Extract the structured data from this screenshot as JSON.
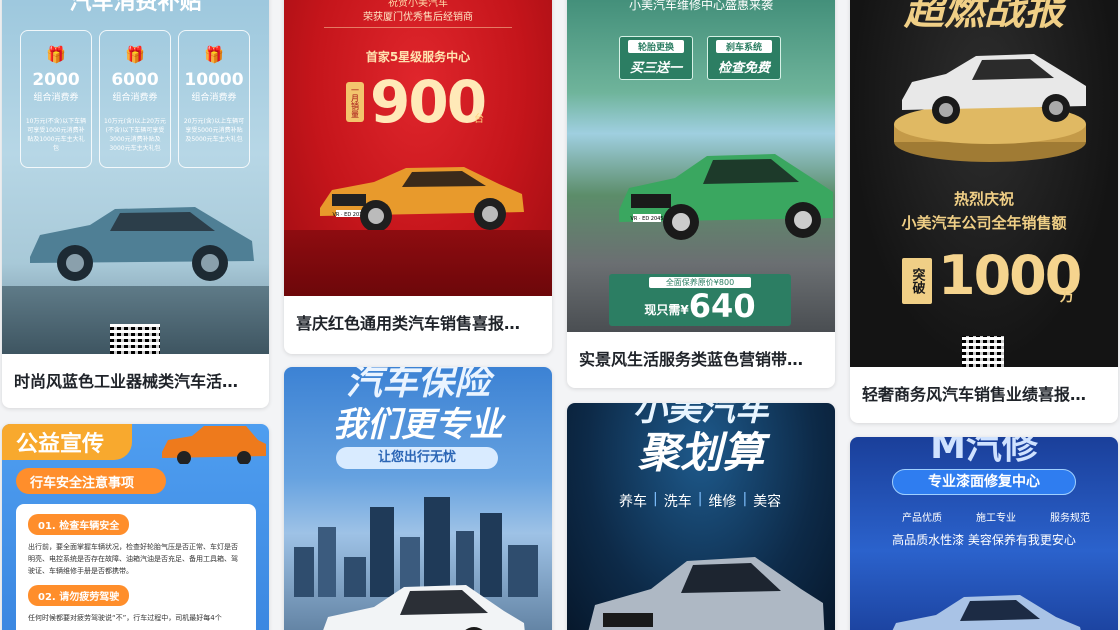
{
  "cards": [
    {
      "title": "时尚风蓝色工业器械类汽车活…",
      "poster": {
        "header": "汽车消费补贴",
        "vouchers": [
          {
            "amount": "2000",
            "label": "组合消费券",
            "desc": "10万元(不含)以下车辆可享受1000元消费补贴及1000元车主大礼包"
          },
          {
            "amount": "6000",
            "label": "组合消费券",
            "desc": "10万元(含)以上20万元(不含)以下车辆可享受3000元消费补贴及3000元车主大礼包"
          },
          {
            "amount": "10000",
            "label": "组合消费券",
            "desc": "20万元(含)以上车辆可享受5000元消费补贴及5000元车主大礼包"
          }
        ]
      }
    },
    {
      "title": "喜庆红色通用类汽车销售喜报…",
      "poster": {
        "top_line1": "祝贺小美汽车",
        "top_line2": "荣获厦门优秀售后经销商",
        "subtitle": "首家5星级服务中心",
        "side_label": "一月销量",
        "number": "900",
        "unit": "台",
        "plate": "VR · ED 2015"
      }
    },
    {
      "title": "实景风生活服务类蓝色营销带…",
      "poster": {
        "top": "小美汽车维修中心盛惠来袭",
        "tag1_head": "轮胎更换",
        "tag1_body": "买三送一",
        "tag2_head": "刹车系统",
        "tag2_body": "检查免费",
        "plate": "VR · ED 2045",
        "orig": "全面保养原价¥800",
        "now_label": "现只需¥",
        "price": "640"
      }
    },
    {
      "title": "轻奢商务风汽车销售业绩喜报…",
      "poster": {
        "header": "超燃战报",
        "line1": "热烈庆祝",
        "line2": "小美汽车公司全年销售额",
        "badge": "突破",
        "number": "1000",
        "unit": "万"
      }
    },
    {
      "title": "",
      "poster": {
        "banner": "公益宣传",
        "sub": "行车安全注意事项",
        "item1_title": "01. 检查车辆安全",
        "item1_text": "出行前，要全面掌握车辆状况，检查好轮胎气压是否正常、车灯是否明亮、电控系统是否存在故障、油箱汽油是否充足、备用工具箱、驾驶证、车辆维修手册是否都携带。",
        "item2_title": "02. 请勿疲劳驾驶",
        "item2_text": "任何时候都要对疲劳驾驶说“不”，行车过程中，司机最好每4个"
      }
    },
    {
      "title": "",
      "poster": {
        "line1": "汽车保险",
        "line2": "我们更专业",
        "pill": "让您出行无忧"
      }
    },
    {
      "title": "",
      "poster": {
        "line1": "小美汽车",
        "line2": "聚划算",
        "services": [
          "养车",
          "洗车",
          "维修",
          "美容"
        ]
      }
    },
    {
      "title": "",
      "poster": {
        "header": "M汽修",
        "pill": "专业漆面修复中心",
        "feats": [
          "产品优质",
          "施工专业",
          "服务规范"
        ],
        "slogan": "高品质水性漆 美容保养有我更安心"
      }
    }
  ],
  "colors": {
    "card1_bg": "#8fbcd6",
    "card2_bg": "#c8171e",
    "card3_bg": "#2f7d6a",
    "card4_bg": "#1a1a1a",
    "card5_bg": "#3f8fe6",
    "card6_bg": "#3b7fd0",
    "card7_bg": "#0e2a4a",
    "card8_bg": "#1f4fb8"
  }
}
